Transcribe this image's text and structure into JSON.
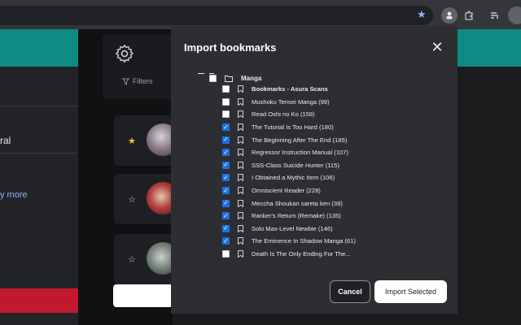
{
  "browser": {
    "bookmark_star_icon": "star-icon",
    "extension_icons": [
      "extension-icon",
      "puzzle-icon",
      "media-queue-icon"
    ]
  },
  "background": {
    "left_text": "ral",
    "left_link": "y more",
    "filters_label": "Filters",
    "brand_colors": {
      "teal": "#0d8c86",
      "red": "#c2182e"
    }
  },
  "modal": {
    "title": "Import bookmarks",
    "root_folder": "Manga",
    "items": [
      {
        "label": "Bookmarks - Asura Scans",
        "checked": false,
        "bold": true
      },
      {
        "label": "Mushoku Tensei Manga (99)",
        "checked": false
      },
      {
        "label": "Read Oshi no Ko (159)",
        "checked": false
      },
      {
        "label": "The Tutorial Is Too Hard (180)",
        "checked": true
      },
      {
        "label": "The Beginning After The End (185)",
        "checked": true
      },
      {
        "label": "Regressor Instruction Manual (107)",
        "checked": true
      },
      {
        "label": "SSS-Class Suicide Hunter (115)",
        "checked": true
      },
      {
        "label": "I Obtained a Mythic Item (106)",
        "checked": true
      },
      {
        "label": "Omniscient Reader (228)",
        "checked": true
      },
      {
        "label": "Meccha Shoukan sareta ken (39)",
        "checked": true
      },
      {
        "label": "Ranker's Return (Remake) (135)",
        "checked": true
      },
      {
        "label": "Solo Max-Level Newbie (146)",
        "checked": true
      },
      {
        "label": "The Eminence In Shadow Manga (61)",
        "checked": true
      },
      {
        "label": "Death Is The Only Ending For The...",
        "checked": false
      }
    ],
    "cancel_label": "Cancel",
    "import_label": "Import Selected",
    "accent_color": "#1a73e8"
  }
}
